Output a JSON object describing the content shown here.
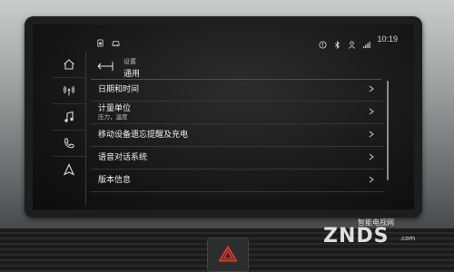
{
  "status_bar": {
    "time": "10:19",
    "left_icons": [
      "phone-battery-icon",
      "car-icon"
    ],
    "right_icons": [
      "alert-icon",
      "bluetooth-icon",
      "person-icon",
      "signal-icon"
    ]
  },
  "sidebar": {
    "items": [
      {
        "icon": "home-icon"
      },
      {
        "icon": "radio-icon"
      },
      {
        "icon": "music-icon"
      },
      {
        "icon": "phone-icon"
      },
      {
        "icon": "navigation-icon"
      }
    ]
  },
  "header": {
    "title": "设置",
    "subtitle": "通用"
  },
  "menu": {
    "items": [
      {
        "label": "日期和时间",
        "sub": ""
      },
      {
        "label": "计量单位",
        "sub": "压力，温度"
      },
      {
        "label": "移动设备遗忘提醒及充电",
        "sub": ""
      },
      {
        "label": "语音对话系统",
        "sub": ""
      },
      {
        "label": "版本信息",
        "sub": ""
      }
    ]
  },
  "watermark": {
    "cn": "智能电视网",
    "logo": "ZNDS",
    "com": ".com"
  },
  "colors": {
    "screen_bg": "#131415",
    "text": "#f2f2f2",
    "accent_line": "#4a4d50",
    "hazard_red": "#e0362a"
  }
}
